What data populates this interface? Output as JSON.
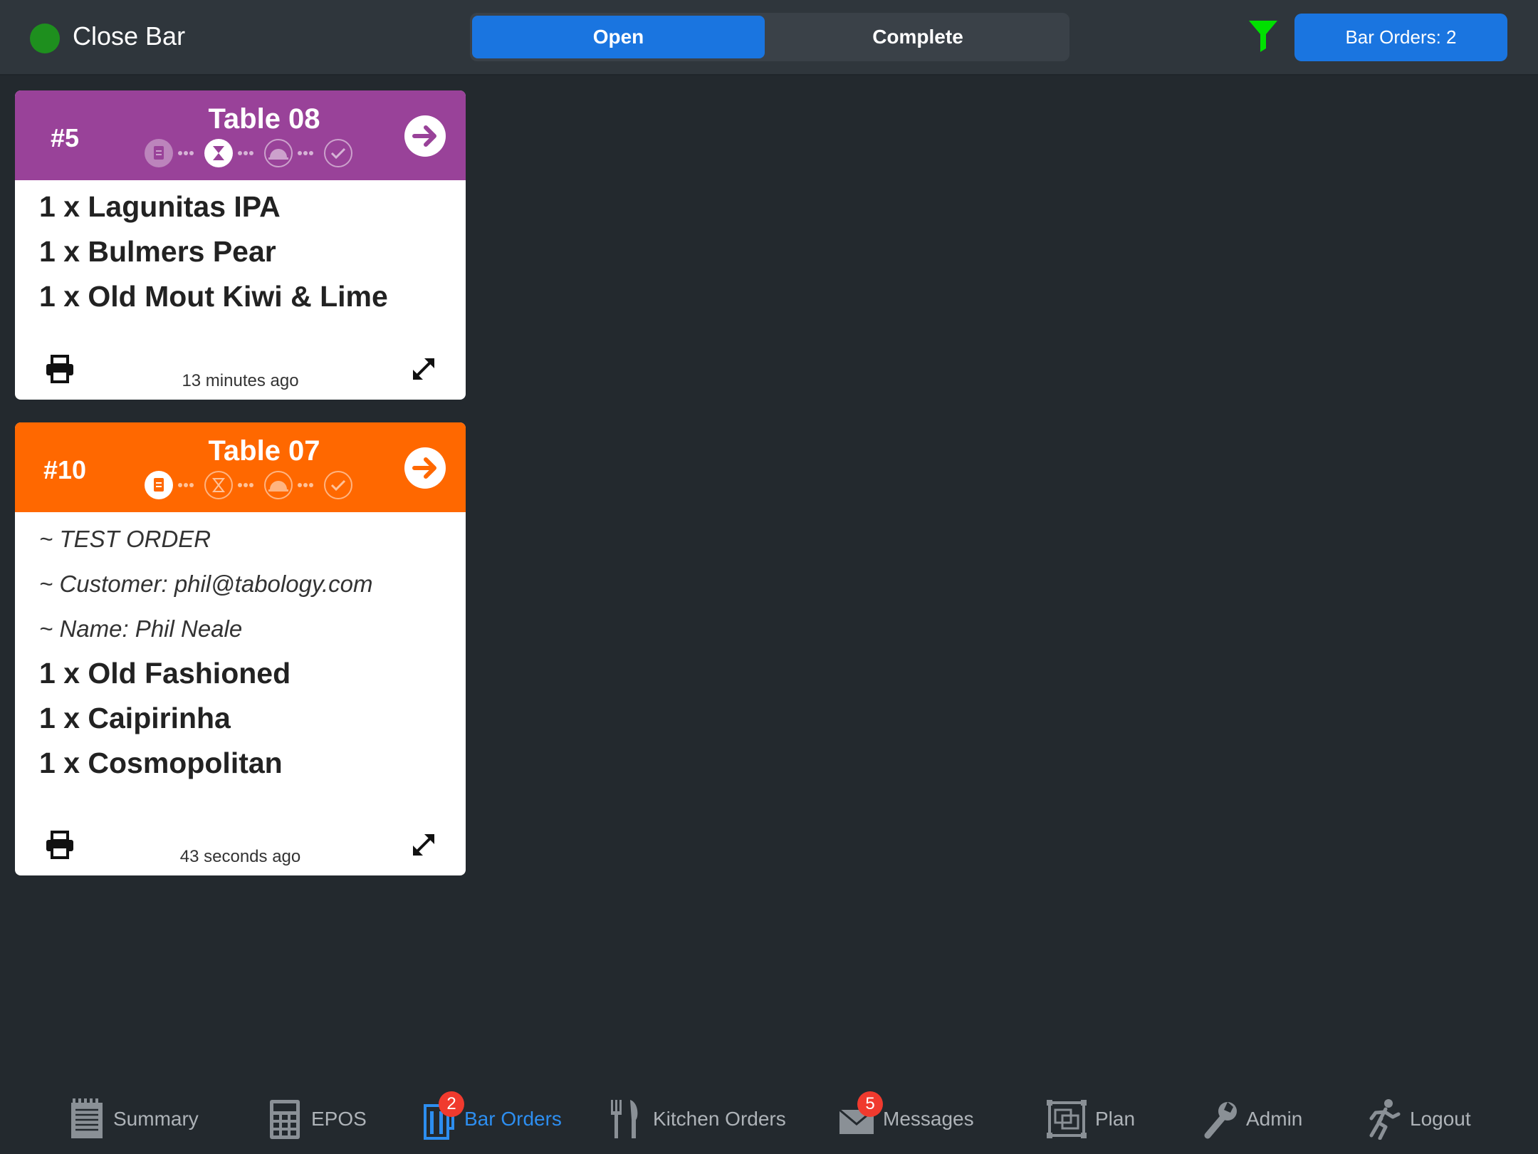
{
  "header": {
    "close_bar_label": "Close Bar",
    "status_color": "#1e8f1e",
    "segments": {
      "open": "Open",
      "complete": "Complete"
    },
    "selected_segment": "Open",
    "filter_icon": "filter-icon",
    "filter_color": "#00e000",
    "bar_orders_button": "Bar Orders: 2"
  },
  "orders": [
    {
      "number": "#5",
      "table": "Table 08",
      "header_color": "#994299",
      "current_stage": "preparing",
      "stage_icons": [
        "receipt-icon",
        "hourglass-icon",
        "cloche-icon",
        "check-icon"
      ],
      "notes": [],
      "items": [
        "1 x Lagunitas IPA",
        "1 x Bulmers Pear",
        "1 x Old Mout Kiwi & Lime"
      ],
      "time": "13 minutes ago"
    },
    {
      "number": "#10",
      "table": "Table 07",
      "header_color": "#ff6800",
      "current_stage": "received",
      "stage_icons": [
        "receipt-icon",
        "hourglass-icon",
        "cloche-icon",
        "check-icon"
      ],
      "notes": [
        "~ TEST ORDER",
        "~ Customer: phil@tabology.com",
        "~ Name: Phil Neale"
      ],
      "items": [
        "1 x Old Fashioned",
        "1 x Caipirinha",
        "1 x Cosmopolitan"
      ],
      "time": "43 seconds ago"
    }
  ],
  "tabs": [
    {
      "label": "Summary",
      "icon": "notepad-icon",
      "active": false,
      "badge": ""
    },
    {
      "label": "EPOS",
      "icon": "calculator-icon",
      "active": false,
      "badge": ""
    },
    {
      "label": "Bar Orders",
      "icon": "glass-icon",
      "active": true,
      "badge": "2"
    },
    {
      "label": "Kitchen Orders",
      "icon": "cutlery-icon",
      "active": false,
      "badge": ""
    },
    {
      "label": "Messages",
      "icon": "envelope-icon",
      "active": false,
      "badge": "5"
    },
    {
      "label": "Plan",
      "icon": "floorplan-icon",
      "active": false,
      "badge": ""
    },
    {
      "label": "Admin",
      "icon": "wrench-icon",
      "active": false,
      "badge": ""
    },
    {
      "label": "Logout",
      "icon": "running-person-icon",
      "active": false,
      "badge": ""
    }
  ],
  "colors": {
    "accent": "#1a75e0",
    "tab_active": "#2d8ef0",
    "tab_inactive": "#aeb3b8",
    "badge": "#f03a2e"
  }
}
